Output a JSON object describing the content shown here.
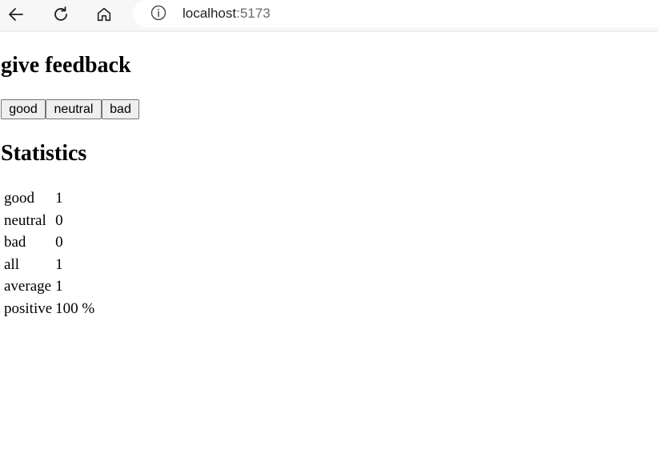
{
  "browser": {
    "url_host": "localhost",
    "url_port": ":5173",
    "icons": {
      "back": "arrow-left-icon",
      "reload": "reload-icon",
      "home": "home-icon",
      "info": "info-icon"
    }
  },
  "page": {
    "heading_feedback": "give feedback",
    "buttons": {
      "good": "good",
      "neutral": "neutral",
      "bad": "bad"
    },
    "heading_stats": "Statistics",
    "stats": [
      {
        "label": "good",
        "value": "1"
      },
      {
        "label": "neutral",
        "value": "0"
      },
      {
        "label": "bad",
        "value": "0"
      },
      {
        "label": "all",
        "value": "1"
      },
      {
        "label": "average",
        "value": "1"
      },
      {
        "label": "positive",
        "value": "100 %"
      }
    ]
  }
}
